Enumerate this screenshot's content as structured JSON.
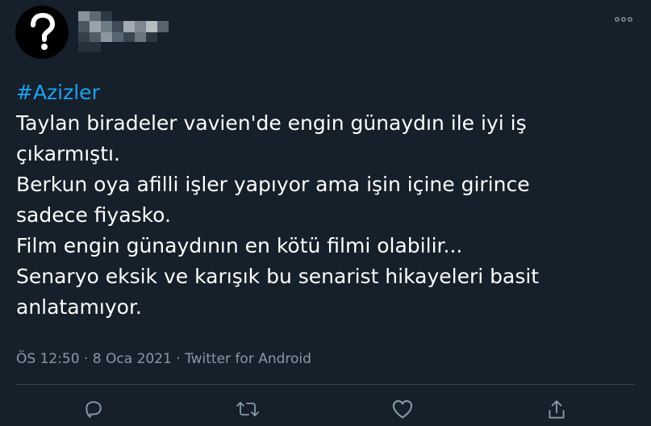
{
  "tweet": {
    "hashtag": "#Azizler",
    "body": "Taylan biradeler vavien'de engin günaydın ile iyi iş\nçıkarmıştı.\nBerkun oya afilli işler yapıyor ama işin içine girince\nsadece fiyasko.\nFilm engin günaydının en kötü filmi olabilir...\nSenaryo eksik ve karışık bu senarist hikayeleri basit\nanlatamıyor.",
    "time": "ÖS 12:50",
    "date": "8 Oca 2021",
    "separator": "·",
    "source": "Twitter for Android"
  },
  "icons": {
    "avatar": "question-mark-avatar",
    "more": "more-dots-icon",
    "reply": "reply-icon",
    "retweet": "retweet-icon",
    "like": "heart-icon",
    "share": "share-icon"
  },
  "colors": {
    "background": "#15202b",
    "text": "#ffffff",
    "accent": "#1da1f2",
    "secondary": "#8899a6"
  }
}
